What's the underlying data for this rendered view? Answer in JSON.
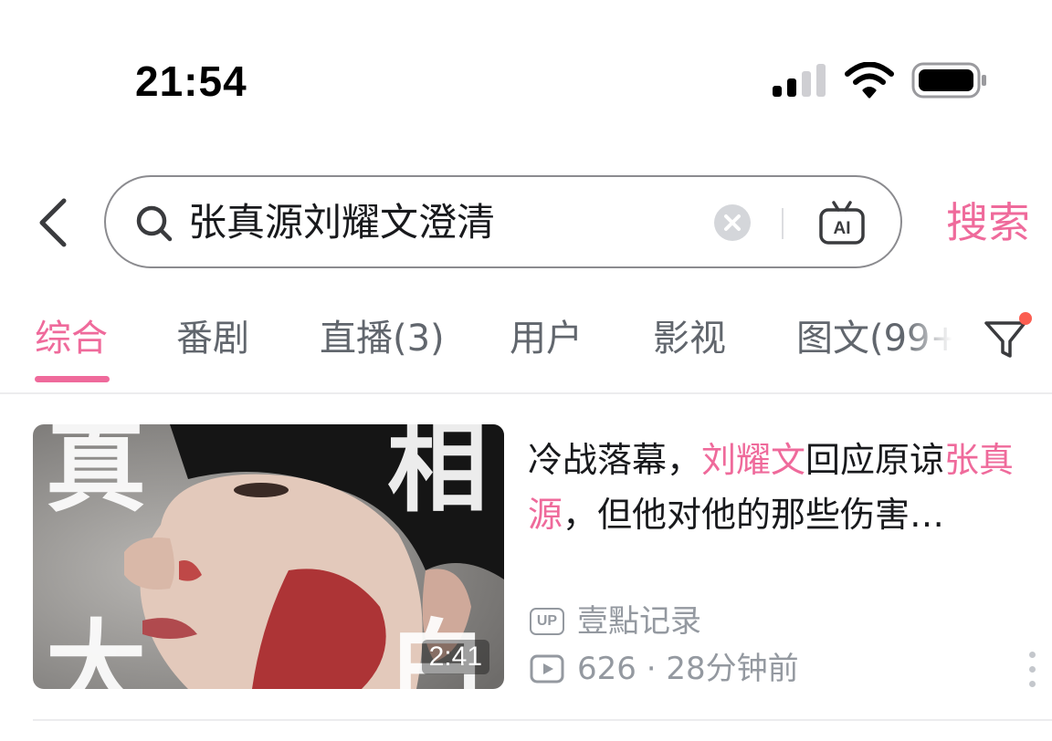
{
  "status_bar": {
    "time": "21:54",
    "signal_icon": "cellular-signal-icon",
    "wifi_icon": "wifi-icon",
    "battery_icon": "battery-icon"
  },
  "search": {
    "back_icon": "chevron-left-icon",
    "search_icon": "magnifier-icon",
    "query": "张真源刘耀文澄清",
    "clear_icon": "clear-circle-icon",
    "ai_icon_label": "AI",
    "button_label": "搜索"
  },
  "tabs": [
    {
      "label": "综合",
      "active": true
    },
    {
      "label": "番剧",
      "active": false
    },
    {
      "label": "直播(3)",
      "active": false
    },
    {
      "label": "用户",
      "active": false
    },
    {
      "label": "影视",
      "active": false
    },
    {
      "label": "图文(99+",
      "active": false
    }
  ],
  "filter_icon": "funnel-filter-icon",
  "results": [
    {
      "thumbnail_text": [
        "真",
        "相",
        "大",
        "白"
      ],
      "duration": "2:41",
      "title_parts": [
        {
          "text": "冷战落幕，",
          "highlight": false
        },
        {
          "text": "刘耀文",
          "highlight": true
        },
        {
          "text": "回应原谅",
          "highlight": false
        },
        {
          "text": "张真源",
          "highlight": true
        },
        {
          "text": "，但他对他的那些伤害…",
          "highlight": false
        }
      ],
      "uploader_badge": "UP",
      "uploader": "壹點记录",
      "stats": "626 · 28分钟前"
    }
  ],
  "colors": {
    "accent": "#ef6a9b",
    "text_primary": "#18191c",
    "text_secondary": "#61666d",
    "text_meta": "#9499a0"
  }
}
